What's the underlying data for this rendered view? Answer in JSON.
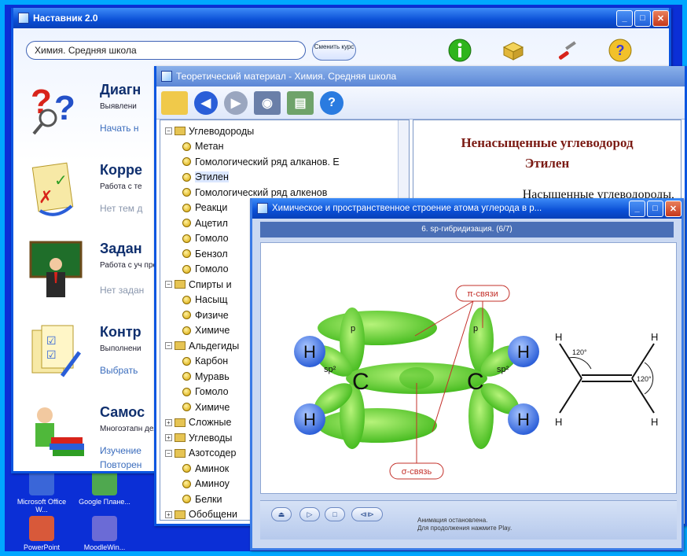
{
  "desktop": {
    "icons": [
      {
        "label": "Microsoft Office W...",
        "color": "#3a66d8"
      },
      {
        "label": "Google Плане...",
        "color": "#4fa84f"
      },
      {
        "label": "PowerPoint",
        "color": "#d8593a"
      },
      {
        "label": "MoodleWin...",
        "color": "#6b6bd6"
      }
    ]
  },
  "main_window": {
    "title": "Наставник 2.0",
    "course_value": "Химия. Средняя школа",
    "change_course_label": "Сменить курс",
    "items": [
      {
        "title": "Диагн",
        "desc": "Выявлени",
        "action": "Начать н"
      },
      {
        "title": "Корре",
        "desc": "Работа с те",
        "action": "Нет тем д"
      },
      {
        "title": "Задан",
        "desc": "Работа с уч преподавате",
        "action": "Нет задан"
      },
      {
        "title": "Контр",
        "desc": "Выполнени",
        "action": "Выбрать"
      },
      {
        "title": "Самос",
        "desc": "Многоэтапн деятельно",
        "action": "Изучение",
        "action2": "Повторен"
      }
    ]
  },
  "theory_window": {
    "title": "Теоретический материал - Химия. Средняя школа",
    "tree": [
      {
        "level": 0,
        "type": "folder",
        "label": "Углеводороды",
        "expanded": true
      },
      {
        "level": 1,
        "type": "leaf",
        "label": "Метан"
      },
      {
        "level": 1,
        "type": "leaf",
        "label": "Гомологический ряд алканов. Е"
      },
      {
        "level": 1,
        "type": "leaf",
        "label": "Этилен",
        "selected": true
      },
      {
        "level": 1,
        "type": "leaf",
        "label": "Гомологический ряд алкенов"
      },
      {
        "level": 1,
        "type": "leaf",
        "label": "Реакци"
      },
      {
        "level": 1,
        "type": "leaf",
        "label": "Ацетил"
      },
      {
        "level": 1,
        "type": "leaf",
        "label": "Гомоло"
      },
      {
        "level": 1,
        "type": "leaf",
        "label": "Бензол"
      },
      {
        "level": 1,
        "type": "leaf",
        "label": "Гомоло"
      },
      {
        "level": 0,
        "type": "folder",
        "label": "Спирты и",
        "expanded": true
      },
      {
        "level": 1,
        "type": "leaf",
        "label": "Насыщ"
      },
      {
        "level": 1,
        "type": "leaf",
        "label": "Физиче"
      },
      {
        "level": 1,
        "type": "leaf",
        "label": "Химиче"
      },
      {
        "level": 0,
        "type": "folder",
        "label": "Альдегиды",
        "expanded": true
      },
      {
        "level": 1,
        "type": "leaf",
        "label": "Карбон"
      },
      {
        "level": 1,
        "type": "leaf",
        "label": "Муравь"
      },
      {
        "level": 1,
        "type": "leaf",
        "label": "Гомоло"
      },
      {
        "level": 1,
        "type": "leaf",
        "label": "Химиче"
      },
      {
        "level": 0,
        "type": "folder",
        "label": "Сложные",
        "expanded": false
      },
      {
        "level": 0,
        "type": "folder",
        "label": "Углеводы",
        "expanded": false
      },
      {
        "level": 0,
        "type": "folder",
        "label": "Азотсодер",
        "expanded": true
      },
      {
        "level": 1,
        "type": "leaf",
        "label": "Аминок"
      },
      {
        "level": 1,
        "type": "leaf",
        "label": "Аминоу"
      },
      {
        "level": 1,
        "type": "leaf",
        "label": "Белки"
      },
      {
        "level": 0,
        "type": "folder",
        "label": "Обобщени",
        "expanded": false
      }
    ],
    "content": {
      "heading_line1": "Ненасыщенные углеводород",
      "heading_line2": "Этилен",
      "paragraph": "Насыщенные углеводороды,"
    }
  },
  "anim_window": {
    "title": "Химическое и пространственное строение атома углерода в р...",
    "subtitle": "6. sp-гибридизация. (6/7)",
    "labels": {
      "pi_bonds": "π-связи",
      "sigma_bond": "σ-связь",
      "p": "p",
      "sp2": "sp²",
      "C": "C",
      "H": "H",
      "angle": "120°"
    },
    "status_line1": "Анимация остановлена.",
    "status_line2": "Для продолжения нажмите Play."
  },
  "colors": {
    "desktop": "#0b2fd6",
    "border": "#00a7ff",
    "titlebar": "#0a4fd6",
    "orbital": "#5fcf2a",
    "hydrogen": "#4b7fe0",
    "heading": "#7b1b14"
  }
}
